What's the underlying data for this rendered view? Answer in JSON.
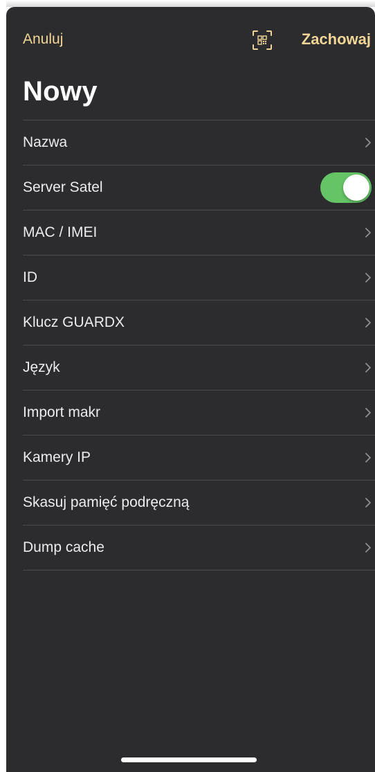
{
  "navbar": {
    "cancel_label": "Anuluj",
    "save_label": "Zachowaj",
    "scan_icon": "qr-scan-icon"
  },
  "title": "Nowy",
  "rows": [
    {
      "label": "Nazwa",
      "accessory": "chevron"
    },
    {
      "label": "Server Satel",
      "accessory": "toggle",
      "toggle_on": true
    },
    {
      "label": "MAC / IMEI",
      "accessory": "chevron"
    },
    {
      "label": "ID",
      "accessory": "chevron"
    },
    {
      "label": "Klucz GUARDX",
      "accessory": "chevron"
    },
    {
      "label": "Język",
      "accessory": "chevron"
    },
    {
      "label": "Import makr",
      "accessory": "chevron"
    },
    {
      "label": "Kamery IP",
      "accessory": "chevron"
    },
    {
      "label": "Skasuj pamięć podręczną",
      "accessory": "chevron"
    },
    {
      "label": "Dump cache",
      "accessory": "chevron"
    }
  ],
  "colors": {
    "background": "#2c2c2e",
    "accent": "#f1d597",
    "toggle_on": "#65c466",
    "separator": "#4a4a4d",
    "text": "#ebebf0"
  }
}
